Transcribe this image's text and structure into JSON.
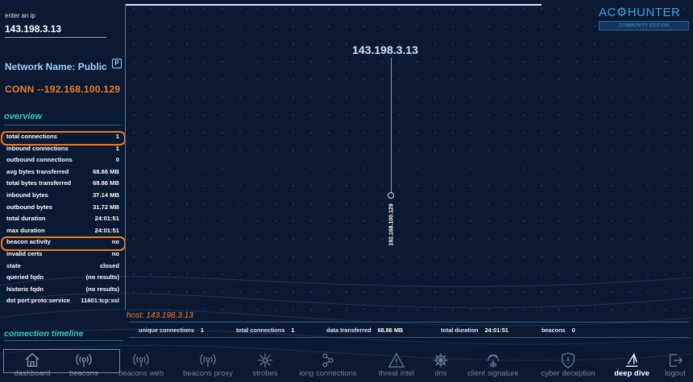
{
  "app": {
    "logo_text": "AC⚙HUNTER",
    "logo_sub": "COMMUNITY EDITION"
  },
  "sidebar": {
    "ip_label": "enter an ip",
    "ip_value": "143.198.3.13",
    "network_name": "Network Name: Public",
    "network_badge": "P",
    "conn_title": "CONN --192.168.100.129",
    "overview_title": "overview",
    "stats": [
      {
        "label": "total connections",
        "value": "1"
      },
      {
        "label": "inbound connections",
        "value": "1"
      },
      {
        "label": "outbound connections",
        "value": "0"
      },
      {
        "label": "avg bytes transferred",
        "value": "68.86 MB"
      },
      {
        "label": "total bytes transferred",
        "value": "68.86 MB"
      },
      {
        "label": "inbound bytes",
        "value": "37.14 MB"
      },
      {
        "label": "outbound bytes",
        "value": "31.72 MB"
      },
      {
        "label": "total duration",
        "value": "24:01:51"
      },
      {
        "label": "max duration",
        "value": "24:01:51"
      },
      {
        "label": "beacon activity",
        "value": "no"
      },
      {
        "label": "invalid certs",
        "value": "no"
      },
      {
        "label": "state",
        "value": "closed"
      },
      {
        "label": "queried fqdn",
        "value": "(no results)"
      },
      {
        "label": "historic fqdn",
        "value": "(no results)"
      },
      {
        "label": "dst port:proto:service",
        "value": "11601:tcp:ssl"
      }
    ],
    "timeline_title": "connection timeline"
  },
  "graph": {
    "root_ip": "143.198.3.13",
    "child_ip": "192.168.100.129"
  },
  "host": {
    "label": "host: 143.198.3.13",
    "stats": [
      {
        "label": "unique connections",
        "value": "1"
      },
      {
        "label": "total connections",
        "value": "1"
      },
      {
        "label": "data transferred",
        "value": "68.86 MB"
      },
      {
        "label": "total duration",
        "value": "24:01:51"
      },
      {
        "label": "beacons",
        "value": "0"
      }
    ]
  },
  "nav": [
    {
      "label": "dashboard",
      "icon": "home-icon"
    },
    {
      "label": "beacons",
      "icon": "beacon-icon"
    },
    {
      "label": "beacons web",
      "icon": "beacon-web-icon"
    },
    {
      "label": "beacons proxy",
      "icon": "beacon-proxy-icon"
    },
    {
      "label": "strobes",
      "icon": "strobe-icon"
    },
    {
      "label": "long connections",
      "icon": "long-connections-icon"
    },
    {
      "label": "threat intel",
      "icon": "warning-icon"
    },
    {
      "label": "dns",
      "icon": "dns-wheel-icon"
    },
    {
      "label": "client signature",
      "icon": "fingerprint-icon"
    },
    {
      "label": "cyber deception",
      "icon": "shield-icon"
    },
    {
      "label": "deep dive",
      "icon": "deep-dive-icon"
    },
    {
      "label": "logout",
      "icon": "logout-icon"
    }
  ],
  "colors": {
    "background": "#0b1a33",
    "accent_orange": "#f07a1e",
    "accent_teal": "#32c8c0",
    "accent_blue": "#3fa0e8"
  }
}
